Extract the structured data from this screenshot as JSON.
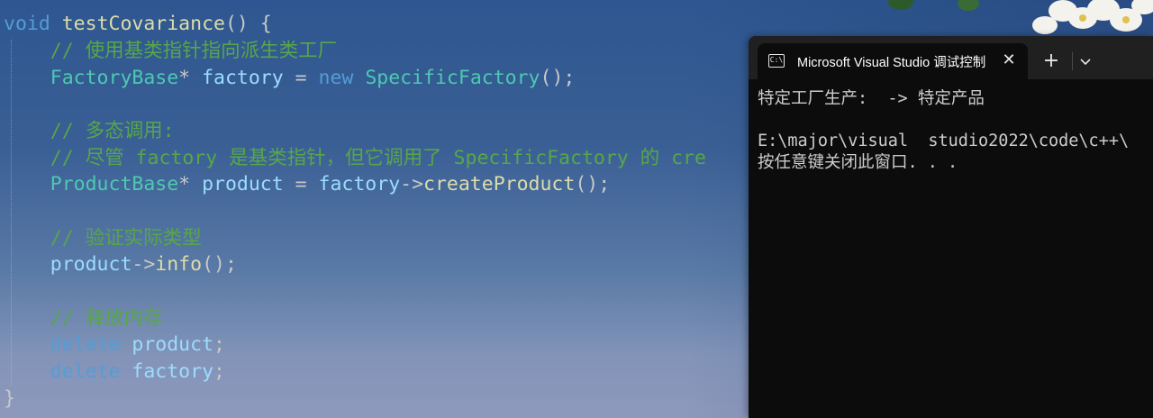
{
  "editor": {
    "lines": {
      "l1": {
        "kw": "void",
        "fn": "testCovariance",
        "rest": "() {"
      },
      "l2": {
        "comment": "// 使用基类指针指向派生类工厂"
      },
      "l3": {
        "type": "FactoryBase",
        "star": "*",
        "var": "factory",
        "eq": " = ",
        "new": "new",
        "ctor": "SpecificFactory",
        "end": "();"
      },
      "l5": {
        "comment": "// 多态调用:"
      },
      "l6": {
        "comment": "// 尽管 factory 是基类指针，但它调用了 SpecificFactory 的 cre"
      },
      "l7": {
        "type": "ProductBase",
        "star": "*",
        "var": "product",
        "eq": " = ",
        "obj": "factory",
        "arrow": "->",
        "method": "createProduct",
        "end": "();"
      },
      "l9": {
        "comment": "// 验证实际类型"
      },
      "l10": {
        "obj": "product",
        "arrow": "->",
        "method": "info",
        "end": "();"
      },
      "l12": {
        "comment": "// 释放内存"
      },
      "l13": {
        "kw": "delete",
        "var": "product",
        "end": ";"
      },
      "l14": {
        "kw": "delete",
        "var": "factory",
        "end": ";"
      },
      "l15": {
        "brace": "}"
      }
    }
  },
  "terminal": {
    "tab_title": "Microsoft Visual Studio 调试控制台",
    "tab_icon_text": "C:\\",
    "close_glyph": "✕",
    "new_tab_glyph": "+",
    "output": [
      "特定工厂生产:  -> 特定产品",
      "",
      "E:\\major\\visual  studio2022\\code\\c++\\",
      "按任意键关闭此窗口. . ."
    ]
  },
  "colors": {
    "keyword": "#569cd6",
    "function": "#dcdcaa",
    "type": "#4ec9b0",
    "variable": "#9cdcfe",
    "comment": "#57a64a",
    "terminal_bg": "#0c0c0c"
  },
  "icons": [
    "terminal-app-icon",
    "close-icon",
    "plus-icon",
    "chevron-down-icon",
    "flower-decoration"
  ]
}
